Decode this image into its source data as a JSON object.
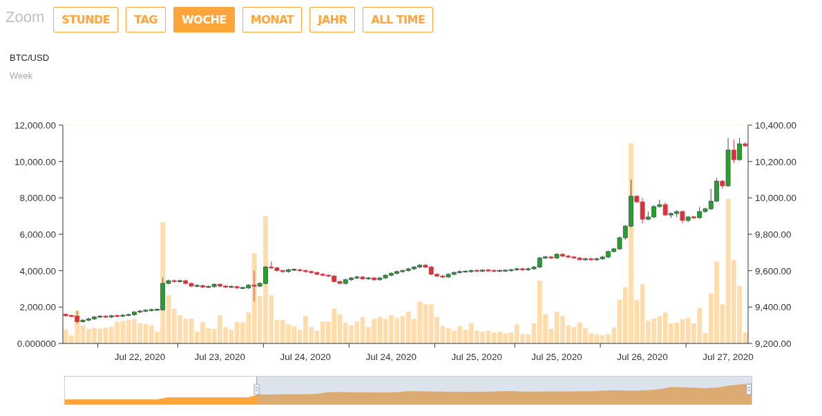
{
  "zoom": {
    "label": "Zoom",
    "buttons": [
      {
        "label": "STUNDE",
        "selected": false
      },
      {
        "label": "TAG",
        "selected": false
      },
      {
        "label": "WOCHE",
        "selected": true
      },
      {
        "label": "MONAT",
        "selected": false
      },
      {
        "label": "JAHR",
        "selected": false
      },
      {
        "label": "ALL TIME",
        "selected": false
      }
    ]
  },
  "chart": {
    "title": "BTC/USD",
    "subtitle": "Week",
    "chart_data": {
      "type": "candlestick",
      "categories": [
        null,
        null,
        null,
        null,
        null,
        null,
        null,
        null,
        null,
        null,
        null,
        null,
        null,
        "Jul 22, 2020",
        null,
        null,
        null,
        null,
        null,
        null,
        null,
        null,
        null,
        null,
        null,
        null,
        null,
        "Jul 23, 2020",
        null,
        null,
        null,
        null,
        null,
        null,
        null,
        null,
        null,
        null,
        null,
        null,
        null,
        null,
        "Jul 24, 2020",
        null,
        null,
        null,
        null,
        null,
        null,
        null,
        null,
        null,
        null,
        null,
        null,
        null,
        null,
        "Jul 24, 2020",
        null,
        null,
        null,
        null,
        null,
        null,
        null,
        null,
        null,
        null,
        null,
        null,
        null,
        null,
        "Jul 25, 2020",
        null,
        null,
        null,
        null,
        null,
        null,
        null,
        null,
        null,
        null,
        null,
        null,
        null,
        "Jul 25, 2020",
        null,
        null,
        null,
        null,
        null,
        null,
        null,
        null,
        null,
        null,
        null,
        null,
        null,
        null,
        "Jul 26, 2020",
        null,
        null,
        null,
        null,
        null,
        null,
        null,
        null,
        null,
        null,
        null,
        null,
        null,
        null,
        "Jul 27, 2020",
        null,
        null,
        null
      ],
      "ylim": [
        9200,
        10400
      ],
      "yticks": [
        {
          "value": 9200,
          "label": "9,200.00"
        },
        {
          "value": 9400,
          "label": "9,400.00"
        },
        {
          "value": 9600,
          "label": "9,600.00"
        },
        {
          "value": 9800,
          "label": "9,800.00"
        },
        {
          "value": 10000,
          "label": "10,000.00"
        },
        {
          "value": 10200,
          "label": "10,200.00"
        },
        {
          "value": 10400,
          "label": "10,400.00"
        }
      ],
      "ohlc": [
        [
          9360,
          9366,
          9346,
          9352
        ],
        [
          9352,
          9358,
          9344,
          9350
        ],
        [
          9350,
          9380,
          9310,
          9320
        ],
        [
          9320,
          9334,
          9314,
          9328
        ],
        [
          9328,
          9341,
          9322,
          9335
        ],
        [
          9335,
          9351,
          9329,
          9345
        ],
        [
          9345,
          9356,
          9339,
          9350
        ],
        [
          9350,
          9356,
          9339,
          9345
        ],
        [
          9345,
          9358,
          9339,
          9352
        ],
        [
          9352,
          9358,
          9344,
          9350
        ],
        [
          9350,
          9361,
          9344,
          9355
        ],
        [
          9355,
          9364,
          9349,
          9358
        ],
        [
          9358,
          9378,
          9352,
          9372
        ],
        [
          9372,
          9384,
          9366,
          9378
        ],
        [
          9378,
          9388,
          9372,
          9382
        ],
        [
          9382,
          9391,
          9376,
          9385
        ],
        [
          9385,
          9391,
          9379,
          9385
        ],
        [
          9385,
          9560,
          9379,
          9530
        ],
        [
          9530,
          9551,
          9524,
          9545
        ],
        [
          9545,
          9551,
          9534,
          9540
        ],
        [
          9540,
          9551,
          9534,
          9545
        ],
        [
          9545,
          9551,
          9524,
          9530
        ],
        [
          9530,
          9536,
          9509,
          9515
        ],
        [
          9515,
          9524,
          9509,
          9518
        ],
        [
          9518,
          9524,
          9504,
          9510
        ],
        [
          9510,
          9518,
          9504,
          9512
        ],
        [
          9512,
          9531,
          9506,
          9525
        ],
        [
          9525,
          9531,
          9509,
          9515
        ],
        [
          9515,
          9521,
          9504,
          9510
        ],
        [
          9510,
          9518,
          9504,
          9512
        ],
        [
          9512,
          9518,
          9499,
          9505
        ],
        [
          9505,
          9511,
          9499,
          9505
        ],
        [
          9505,
          9526,
          9499,
          9520
        ],
        [
          9520,
          9600,
          9430,
          9515
        ],
        [
          9515,
          9536,
          9509,
          9530
        ],
        [
          9530,
          9626,
          9524,
          9620
        ],
        [
          9620,
          9650,
          9609,
          9615
        ],
        [
          9615,
          9621,
          9594,
          9600
        ],
        [
          9600,
          9606,
          9589,
          9595
        ],
        [
          9595,
          9611,
          9589,
          9605
        ],
        [
          9605,
          9611,
          9599,
          9605
        ],
        [
          9605,
          9611,
          9594,
          9600
        ],
        [
          9600,
          9606,
          9589,
          9595
        ],
        [
          9595,
          9601,
          9584,
          9590
        ],
        [
          9590,
          9596,
          9574,
          9580
        ],
        [
          9580,
          9586,
          9569,
          9575
        ],
        [
          9575,
          9581,
          9564,
          9570
        ],
        [
          9570,
          9576,
          9534,
          9540
        ],
        [
          9540,
          9546,
          9524,
          9530
        ],
        [
          9530,
          9556,
          9524,
          9550
        ],
        [
          9550,
          9566,
          9544,
          9560
        ],
        [
          9560,
          9571,
          9554,
          9565
        ],
        [
          9565,
          9571,
          9549,
          9555
        ],
        [
          9555,
          9566,
          9549,
          9560
        ],
        [
          9560,
          9566,
          9544,
          9550
        ],
        [
          9550,
          9566,
          9544,
          9560
        ],
        [
          9560,
          9581,
          9554,
          9575
        ],
        [
          9575,
          9591,
          9569,
          9585
        ],
        [
          9585,
          9601,
          9579,
          9595
        ],
        [
          9595,
          9606,
          9589,
          9600
        ],
        [
          9600,
          9616,
          9594,
          9610
        ],
        [
          9610,
          9626,
          9604,
          9620
        ],
        [
          9620,
          9636,
          9614,
          9630
        ],
        [
          9630,
          9636,
          9614,
          9620
        ],
        [
          9620,
          9626,
          9574,
          9580
        ],
        [
          9580,
          9586,
          9564,
          9570
        ],
        [
          9570,
          9576,
          9559,
          9565
        ],
        [
          9565,
          9586,
          9559,
          9580
        ],
        [
          9580,
          9596,
          9574,
          9590
        ],
        [
          9590,
          9601,
          9584,
          9595
        ],
        [
          9595,
          9601,
          9589,
          9595
        ],
        [
          9595,
          9606,
          9589,
          9600
        ],
        [
          9600,
          9606,
          9592,
          9598
        ],
        [
          9598,
          9608,
          9592,
          9602
        ],
        [
          9602,
          9608,
          9594,
          9600
        ],
        [
          9600,
          9606,
          9592,
          9598
        ],
        [
          9598,
          9606,
          9592,
          9600
        ],
        [
          9600,
          9606,
          9594,
          9600
        ],
        [
          9600,
          9611,
          9594,
          9605
        ],
        [
          9605,
          9616,
          9599,
          9610
        ],
        [
          9610,
          9616,
          9599,
          9605
        ],
        [
          9605,
          9616,
          9599,
          9610
        ],
        [
          9610,
          9626,
          9604,
          9620
        ],
        [
          9620,
          9676,
          9614,
          9670
        ],
        [
          9670,
          9681,
          9664,
          9675
        ],
        [
          9675,
          9681,
          9664,
          9670
        ],
        [
          9670,
          9696,
          9664,
          9690
        ],
        [
          9690,
          9696,
          9674,
          9680
        ],
        [
          9680,
          9686,
          9669,
          9675
        ],
        [
          9675,
          9681,
          9664,
          9670
        ],
        [
          9670,
          9676,
          9654,
          9660
        ],
        [
          9660,
          9671,
          9654,
          9665
        ],
        [
          9665,
          9671,
          9654,
          9660
        ],
        [
          9660,
          9671,
          9654,
          9665
        ],
        [
          9665,
          9681,
          9659,
          9675
        ],
        [
          9675,
          9711,
          9669,
          9705
        ],
        [
          9705,
          9726,
          9699,
          9720
        ],
        [
          9720,
          9787,
          9714,
          9781
        ],
        [
          9781,
          9851,
          9770,
          9845
        ],
        [
          9845,
          10100,
          9839,
          10009
        ],
        [
          10009,
          10015,
          9972,
          9978
        ],
        [
          9978,
          10000,
          9860,
          9883
        ],
        [
          9883,
          9925,
          9877,
          9895
        ],
        [
          9895,
          9960,
          9889,
          9952
        ],
        [
          9952,
          9990,
          9946,
          9963
        ],
        [
          9963,
          9975,
          9900,
          9906
        ],
        [
          9906,
          9920,
          9890,
          9914
        ],
        [
          9914,
          9931,
          9895,
          9925
        ],
        [
          9925,
          9931,
          9860,
          9876
        ],
        [
          9876,
          9901,
          9866,
          9895
        ],
        [
          9895,
          9901,
          9885,
          9891
        ],
        [
          9891,
          9950,
          9885,
          9925
        ],
        [
          9925,
          9946,
          9919,
          9940
        ],
        [
          9940,
          10050,
          9934,
          9982
        ],
        [
          9982,
          10110,
          9976,
          10092
        ],
        [
          10092,
          10098,
          10050,
          10066
        ],
        [
          10066,
          10330,
          10060,
          10263
        ],
        [
          10263,
          10320,
          10190,
          10210
        ],
        [
          10210,
          10330,
          10204,
          10297
        ],
        [
          10297,
          10305,
          10280,
          10286
        ]
      ]
    },
    "volume": {
      "chart_data": {
        "type": "bar",
        "ylim": [
          0,
          12000
        ],
        "yticks": [
          {
            "value": 0,
            "label": "0.000000"
          },
          {
            "value": 2000,
            "label": "2,000.00"
          },
          {
            "value": 4000,
            "label": "4,000.00"
          },
          {
            "value": 6000,
            "label": "6,000.00"
          },
          {
            "value": 8000,
            "label": "8,000.00"
          },
          {
            "value": 10000,
            "label": "10,000.00"
          },
          {
            "value": 12000,
            "label": "12,000.00"
          }
        ],
        "series": [
          {
            "color": "#ffdcaa",
            "values": [
              750,
              450,
              1800,
              1000,
              800,
              870,
              820,
              870,
              920,
              1200,
              1230,
              1290,
              1350,
              1100,
              1070,
              1000,
              650,
              6650,
              2650,
              1900,
              1550,
              1350,
              1370,
              650,
              1180,
              850,
              800,
              1550,
              900,
              750,
              1180,
              1150,
              1700,
              4950,
              2600,
              7000,
              2650,
              1300,
              1300,
              1050,
              950,
              750,
              1500,
              900,
              700,
              1200,
              1200,
              1900,
              1600,
              1150,
              1000,
              1200,
              1450,
              900,
              1350,
              1450,
              1350,
              1550,
              1400,
              1500,
              1750,
              1350,
              2300,
              2150,
              2150,
              1450,
              950,
              850,
              700,
              950,
              750,
              1100,
              700,
              650,
              700,
              600,
              650,
              550,
              600,
              1050,
              500,
              500,
              1100,
              3450,
              1600,
              800,
              1750,
              1500,
              1000,
              900,
              1150,
              850,
              550,
              500,
              450,
              500,
              870,
              2400,
              3100,
              11000,
              2400,
              3250,
              1250,
              1370,
              1500,
              1700,
              1100,
              1150,
              1330,
              1400,
              1100,
              1950,
              570,
              2750,
              4500,
              2150,
              7950,
              4600,
              3150,
              600
            ]
          }
        ]
      }
    }
  }
}
